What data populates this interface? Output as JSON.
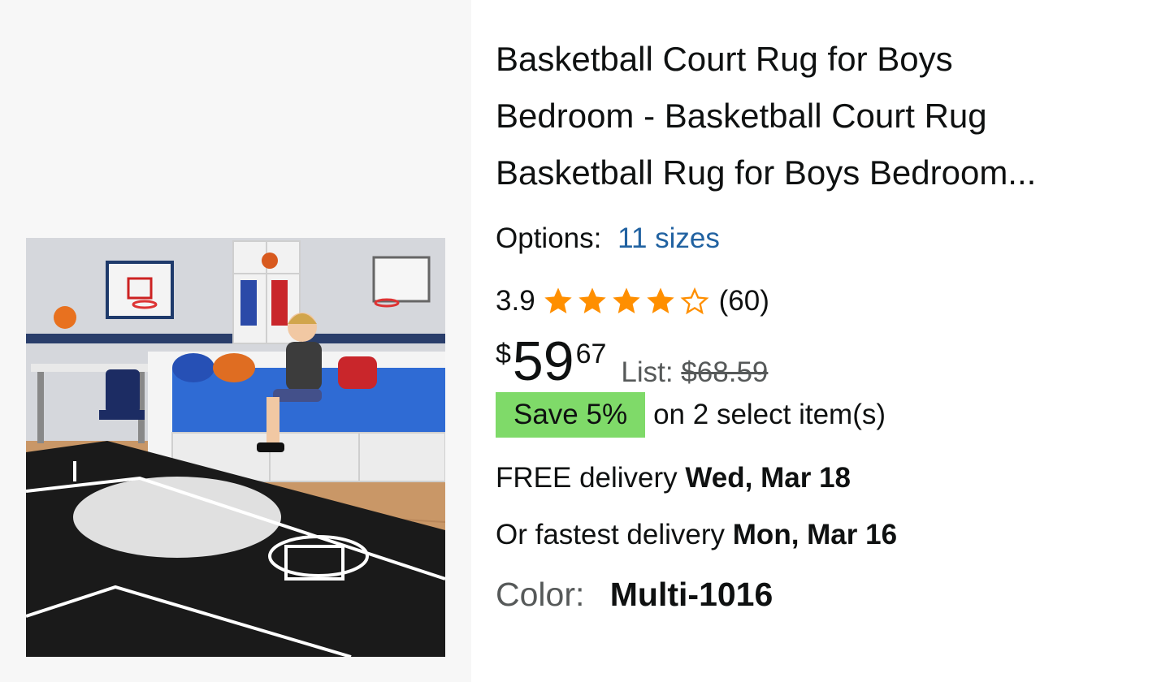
{
  "product": {
    "title_lines": [
      "Basketball Court Rug for Boys",
      "Bedroom - Basketball Court Rug",
      "Basketball Rug for Boys Bedroom..."
    ],
    "image_alt": "Basketball court rug in a boy's bedroom",
    "options_label": "Options:",
    "options_link": "11 sizes",
    "rating_value": "3.9",
    "rating_stars": 3.9,
    "rating_count": "(60)",
    "price_symbol": "$",
    "price_whole": "59",
    "price_fraction": "67",
    "list_label": "List:",
    "list_price": "$68.59",
    "save_badge": "Save 5%",
    "save_text": "on 2 select item(s)",
    "delivery_prefix": "FREE delivery",
    "delivery_date": "Wed, Mar 18",
    "fastest_prefix": "Or fastest delivery",
    "fastest_date": "Mon, Mar 16",
    "color_label": "Color:",
    "color_value": "Multi-1016"
  },
  "colors": {
    "star": "#ff8f00",
    "link": "#2162a1",
    "save_badge_bg": "#7fda69",
    "muted_text": "#565959"
  },
  "icons": {
    "star_full": "star-full-icon",
    "star_empty": "star-outline-icon"
  }
}
